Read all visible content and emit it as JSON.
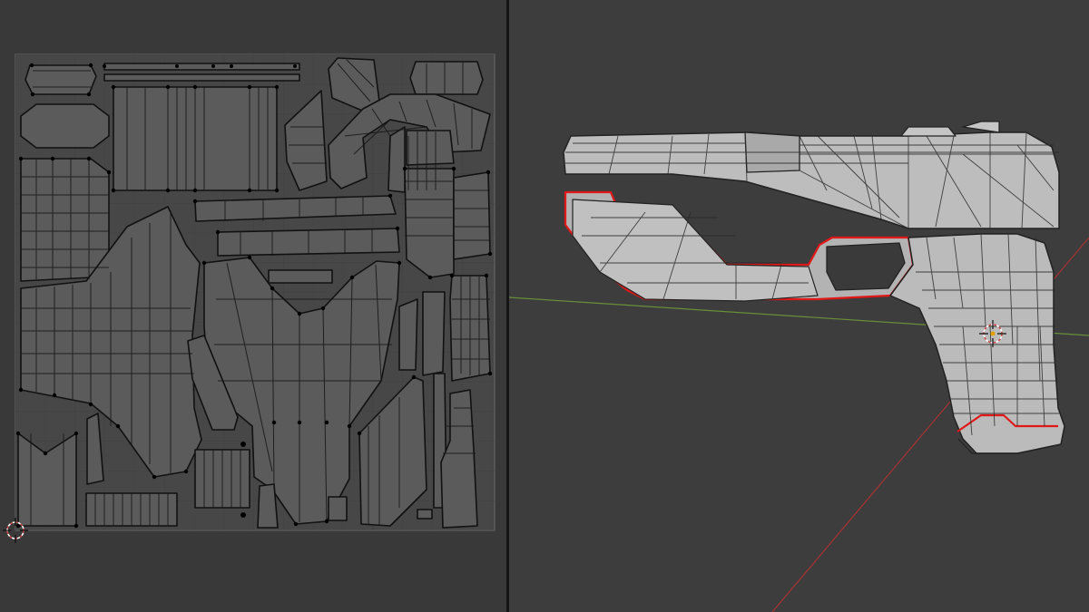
{
  "app": {
    "editors": [
      "uv-editor",
      "3d-viewport"
    ]
  },
  "uv_editor": {
    "background": "#393939",
    "uv_area_fill": "#4a4a4a",
    "island_fill": "#5a5a5a",
    "edge_color": "#111111",
    "vertex_color": "#000000",
    "cursor_icon": "2d-cursor-icon"
  },
  "viewport": {
    "background": "#3d3d3d",
    "x_axis_color": "#a83232",
    "y_axis_color": "#6a8f3a",
    "mesh_fill": "#b9b9b9",
    "wire_color": "#2a2a2a",
    "seam_color": "#e01818",
    "cursor_icon": "3d-cursor-icon",
    "object": "pistol"
  }
}
